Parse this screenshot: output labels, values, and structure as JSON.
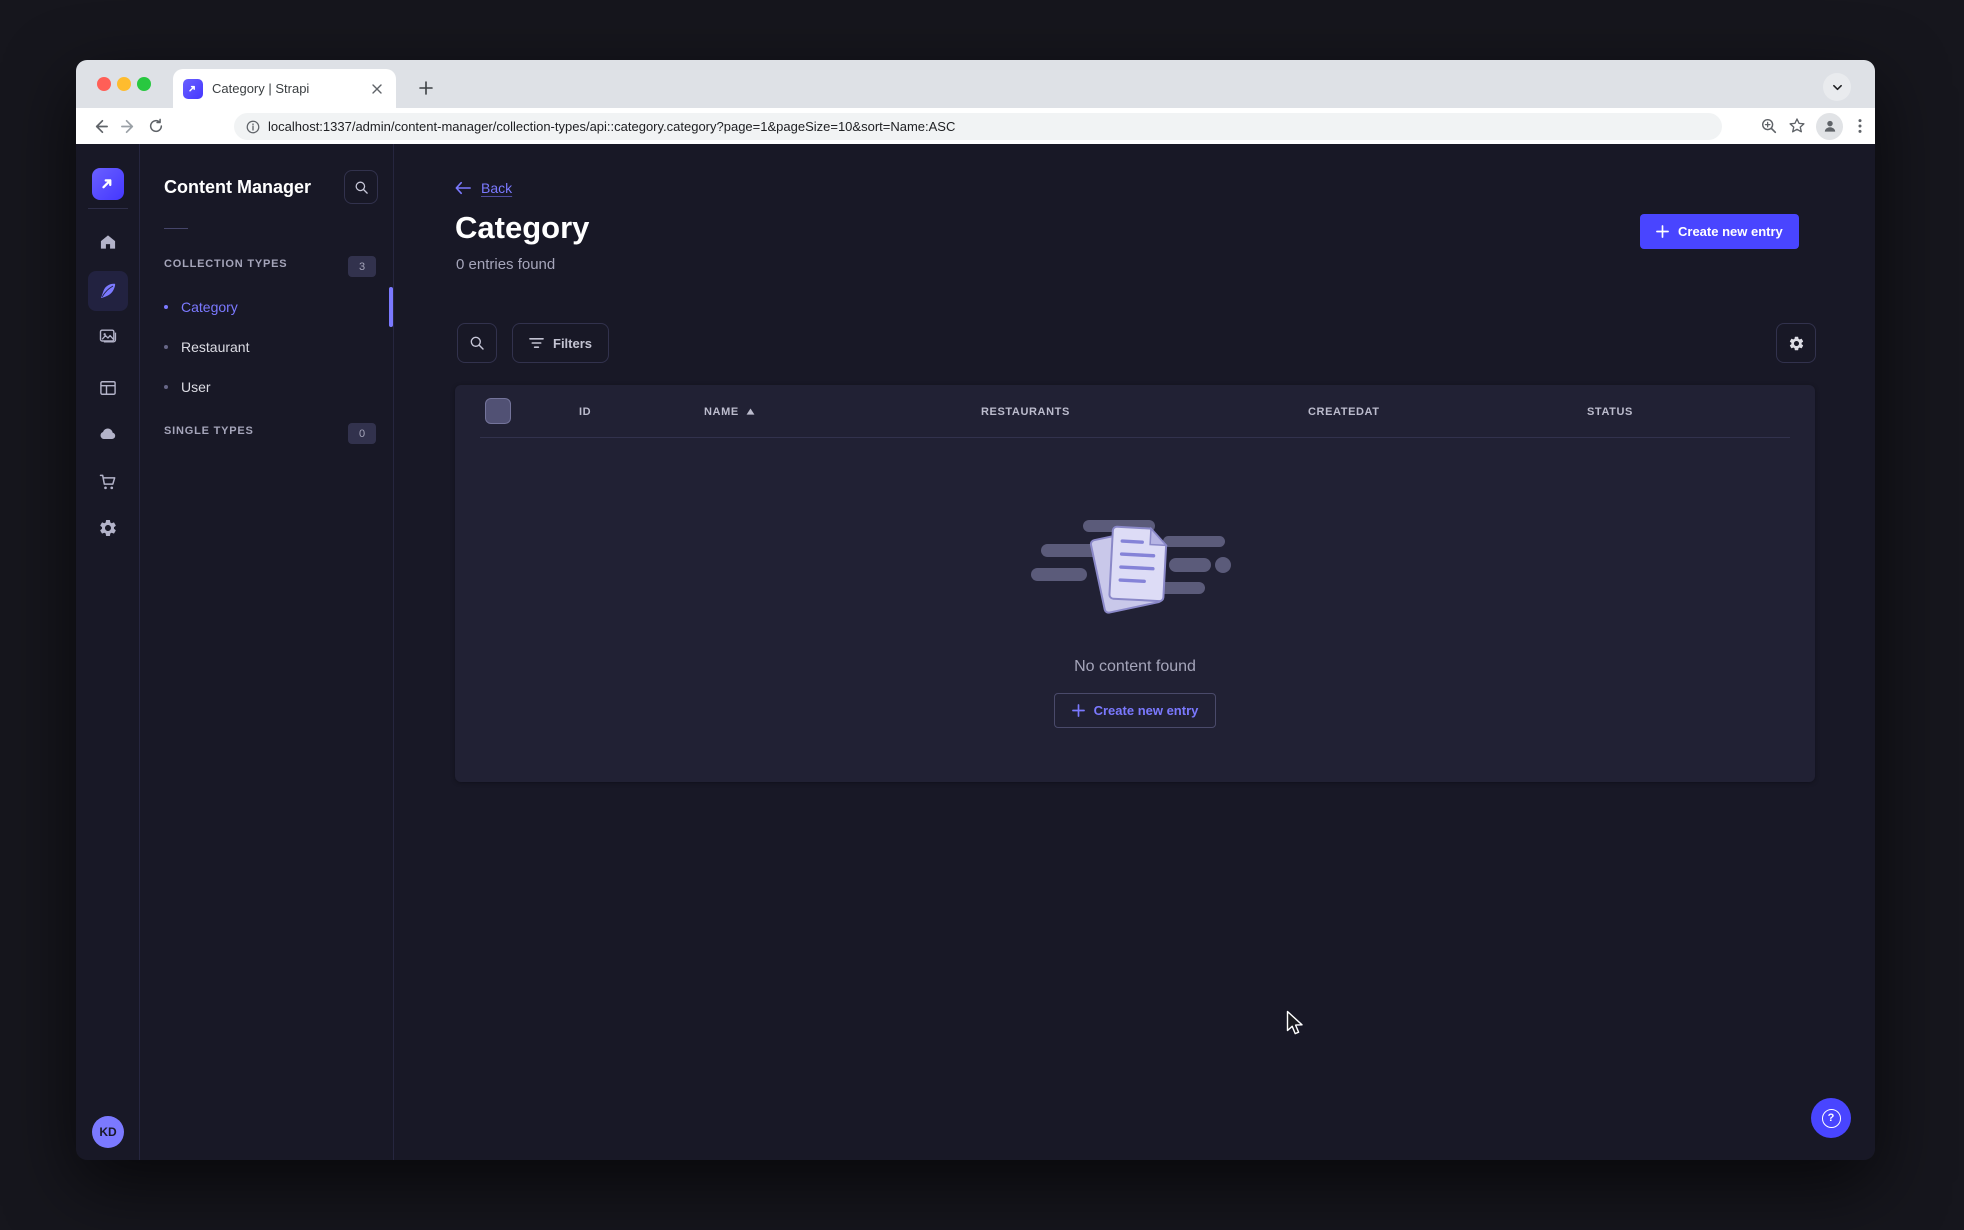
{
  "browser": {
    "tab_title": "Category | Strapi",
    "url": "localhost:1337/admin/content-manager/collection-types/api::category.category?page=1&pageSize=10&sort=Name:ASC"
  },
  "subnav": {
    "title": "Content Manager",
    "collection_types": {
      "label": "COLLECTION TYPES",
      "badge": "3",
      "items": [
        {
          "label": "Category",
          "active": true
        },
        {
          "label": "Restaurant",
          "active": false
        },
        {
          "label": "User",
          "active": false
        }
      ]
    },
    "single_types": {
      "label": "SINGLE TYPES",
      "badge": "0"
    }
  },
  "header": {
    "back_label": "Back",
    "title": "Category",
    "subtitle": "0 entries found",
    "create_button": "Create new entry"
  },
  "filters": {
    "label": "Filters"
  },
  "table": {
    "columns": [
      "ID",
      "NAME",
      "RESTAURANTS",
      "CREATEDAT",
      "STATUS"
    ],
    "sorted_column": "NAME",
    "sort_direction": "ASC"
  },
  "empty_state": {
    "message": "No content found",
    "create_button": "Create new entry"
  },
  "user": {
    "initials": "KD"
  },
  "help": {
    "icon_glyph": "?"
  },
  "colors": {
    "primary": "#4945ff",
    "link": "#7b79ff",
    "surface": "#212134",
    "background": "#181826"
  }
}
